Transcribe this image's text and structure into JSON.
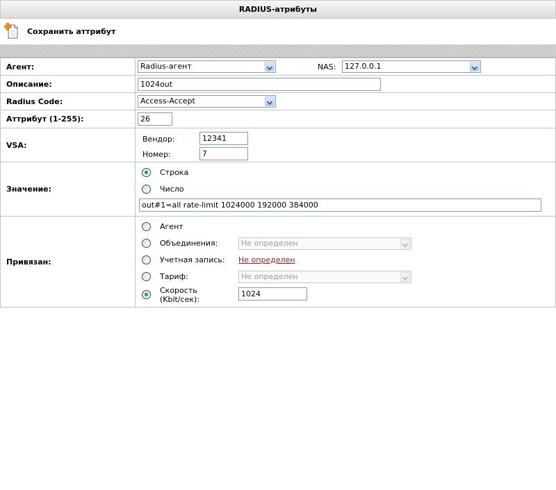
{
  "header": {
    "title": "RADIUS-атрибуты"
  },
  "toolbar": {
    "save_label": "Сохранить аттрибут"
  },
  "form": {
    "agent": {
      "label": "Агент:",
      "value": "Radius-агент"
    },
    "nas": {
      "label": "NAS:",
      "value": "127.0.0.1"
    },
    "description": {
      "label": "Описание:",
      "value": "1024out"
    },
    "radius_code": {
      "label": "Radius Code:",
      "value": "Access-Accept"
    },
    "attribute": {
      "label": "Аттрибут (1-255):",
      "value": "26"
    },
    "vsa": {
      "label": "VSA:",
      "vendor_label": "Вендор:",
      "vendor_value": "12341",
      "number_label": "Номер:",
      "number_value": "7"
    },
    "value": {
      "label": "Значение:",
      "option_string": "Строка",
      "option_number": "Число",
      "selected": "Строка",
      "text": "out#1=all rate-limit 1024000 192000 384000"
    },
    "bound": {
      "label": "Привязан:",
      "agent_label": "Агент",
      "groups_label": "Объединения:",
      "groups_value": "Не определен",
      "account_label": "Учетная запись:",
      "account_link": "Не определен",
      "tariff_label": "Тариф:",
      "tariff_value": "Не определен",
      "speed_label_1": "Скорость",
      "speed_label_2": "(Kbit/сек):",
      "speed_value": "1024",
      "selected": "Скорость (Kbit/сек):"
    }
  }
}
